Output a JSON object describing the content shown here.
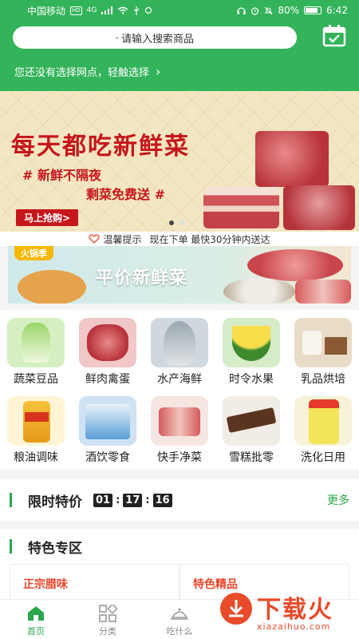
{
  "status_bar": {
    "carrier": "中国移动",
    "hd": "HD",
    "network": "4G",
    "battery": "80%",
    "time": "6:42"
  },
  "header": {
    "search_placeholder": "请输入搜索商品",
    "station_prompt": "您还没有选择网点，轻触选择",
    "station_arrow": "›"
  },
  "banner": {
    "headline": "每天都吃新鲜菜",
    "line1": "# 新鲜不隔夜",
    "line2": "剩菜免费送 #",
    "cta": "马上抢购>",
    "page_count": 2,
    "active_page": 0
  },
  "notice": {
    "label": "温馨提示",
    "text": "现在下单 最快30分钟内送达"
  },
  "promo": {
    "tag": "火锅季",
    "text": "平价新鲜菜"
  },
  "categories": [
    {
      "label": "蔬菜豆品",
      "color": "#d6efc2"
    },
    {
      "label": "鲜肉禽蛋",
      "color": "#f1c7c7"
    },
    {
      "label": "水产海鲜",
      "color": "#cfd8de"
    },
    {
      "label": "时令水果",
      "color": "#f3e39a"
    },
    {
      "label": "乳品烘培",
      "color": "#e9dcc7"
    },
    {
      "label": "粮油调味",
      "color": "#f5d37a"
    },
    {
      "label": "酒饮零食",
      "color": "#cfe2f3"
    },
    {
      "label": "快手净菜",
      "color": "#f2c9bf"
    },
    {
      "label": "雪糕批零",
      "color": "#d9c2a8"
    },
    {
      "label": "洗化日用",
      "color": "#e6ebb4"
    }
  ],
  "flash_sale": {
    "title": "限时特价",
    "hours": "01",
    "minutes": "17",
    "seconds": "16",
    "sep": ":",
    "more": "更多"
  },
  "featured": {
    "title": "特色专区",
    "cards": [
      "正宗腊味",
      "特色精品"
    ]
  },
  "tabbar": {
    "tabs": [
      {
        "label": "首页"
      },
      {
        "label": "分类"
      },
      {
        "label": "吃什么"
      }
    ]
  },
  "watermark": {
    "brand": "下载火",
    "url": "xiazaihuo.com"
  },
  "colors": {
    "brand_green": "#33b35a",
    "accent_red": "#c6161b",
    "watermark_red": "#e84b2a"
  }
}
